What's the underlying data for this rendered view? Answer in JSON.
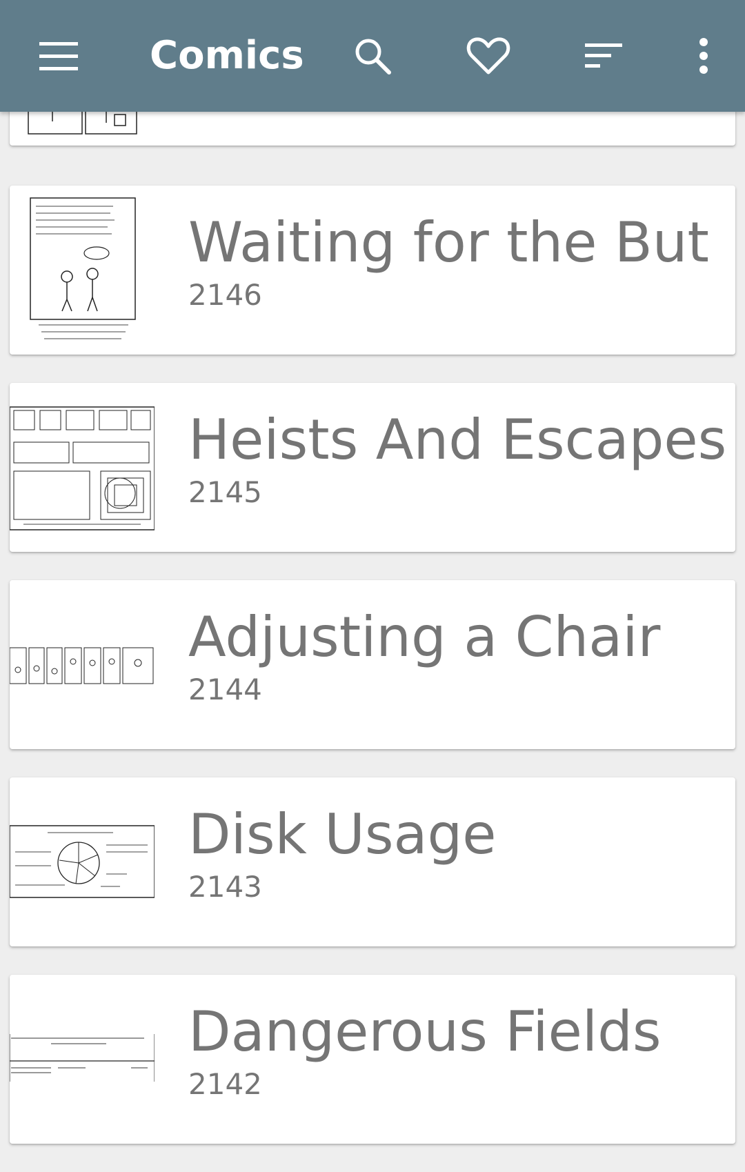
{
  "toolbar": {
    "title": "Comics",
    "icons": [
      "menu-icon",
      "search-icon",
      "heart-icon",
      "sort-icon",
      "more-vert-icon"
    ]
  },
  "comics": [
    {
      "title": "Waiting for the But",
      "number": "2146"
    },
    {
      "title": "Heists And Escapes",
      "number": "2145"
    },
    {
      "title": "Adjusting a Chair",
      "number": "2144"
    },
    {
      "title": "Disk Usage",
      "number": "2143"
    },
    {
      "title": "Dangerous Fields",
      "number": "2142"
    }
  ],
  "colors": {
    "appbar": "#607d8b",
    "background": "#eeeeee",
    "card": "#ffffff",
    "text": "#757575"
  }
}
